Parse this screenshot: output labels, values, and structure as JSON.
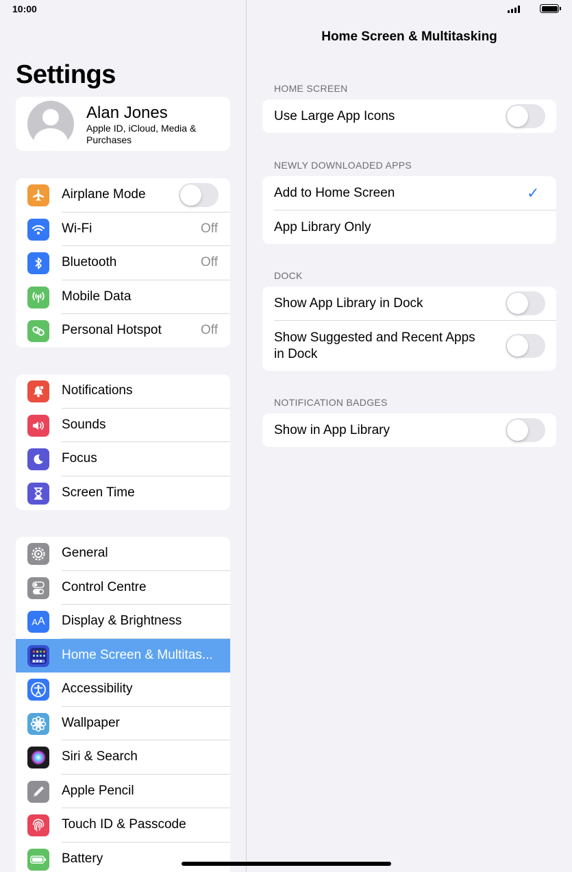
{
  "status": {
    "time": "10:00"
  },
  "sidebar": {
    "title": "Settings",
    "profile": {
      "name": "Alan Jones",
      "subtitle": "Apple ID, iCloud, Media & Purchases"
    },
    "group1": [
      {
        "label": "Airplane Mode",
        "icon": "airplane-icon",
        "color": "#f19a37",
        "toggle": false
      },
      {
        "label": "Wi-Fi",
        "icon": "wifi-icon",
        "color": "#3478f6",
        "value": "Off"
      },
      {
        "label": "Bluetooth",
        "icon": "bluetooth-icon",
        "color": "#3478f6",
        "value": "Off"
      },
      {
        "label": "Mobile Data",
        "icon": "antenna-icon",
        "color": "#5fc163"
      },
      {
        "label": "Personal Hotspot",
        "icon": "hotspot-icon",
        "color": "#5fc163",
        "value": "Off"
      }
    ],
    "group2": [
      {
        "label": "Notifications",
        "icon": "bell-icon",
        "color": "#ea4e3d"
      },
      {
        "label": "Sounds",
        "icon": "speaker-icon",
        "color": "#e9445a"
      },
      {
        "label": "Focus",
        "icon": "moon-icon",
        "color": "#5956d5"
      },
      {
        "label": "Screen Time",
        "icon": "hourglass-icon",
        "color": "#5956d5"
      }
    ],
    "group3": [
      {
        "label": "General",
        "icon": "gear-icon",
        "color": "#8e8e93"
      },
      {
        "label": "Control Centre",
        "icon": "switches-icon",
        "color": "#8e8e93"
      },
      {
        "label": "Display & Brightness",
        "icon": "text-size-icon",
        "color": "#3478f6"
      },
      {
        "label": "Home Screen & Multitas...",
        "icon": "home-grid-icon",
        "color": "#3750d4",
        "selected": true
      },
      {
        "label": "Accessibility",
        "icon": "accessibility-icon",
        "color": "#3478f6"
      },
      {
        "label": "Wallpaper",
        "icon": "flower-icon",
        "color": "#54a6dc"
      },
      {
        "label": "Siri & Search",
        "icon": "siri-icon",
        "color": "#1c1c1e"
      },
      {
        "label": "Apple Pencil",
        "icon": "pencil-icon",
        "color": "#8e8e93"
      },
      {
        "label": "Touch ID & Passcode",
        "icon": "fingerprint-icon",
        "color": "#e9445a"
      },
      {
        "label": "Battery",
        "icon": "battery-icon",
        "color": "#5fc163"
      }
    ]
  },
  "detail": {
    "title": "Home Screen & Multitasking",
    "sections": {
      "home_screen": {
        "header": "HOME SCREEN",
        "rows": [
          {
            "label": "Use Large App Icons",
            "toggle": false
          }
        ]
      },
      "newly_downloaded": {
        "header": "NEWLY DOWNLOADED APPS",
        "rows": [
          {
            "label": "Add to Home Screen",
            "checked": true,
            "check": "✓"
          },
          {
            "label": "App Library Only",
            "checked": false
          }
        ]
      },
      "dock": {
        "header": "DOCK",
        "rows": [
          {
            "label": "Show App Library in Dock",
            "toggle": false
          },
          {
            "label": "Show Suggested and Recent Apps in Dock",
            "toggle": false
          }
        ]
      },
      "badges": {
        "header": "NOTIFICATION BADGES",
        "rows": [
          {
            "label": "Show in App Library",
            "toggle": false
          }
        ]
      }
    }
  }
}
